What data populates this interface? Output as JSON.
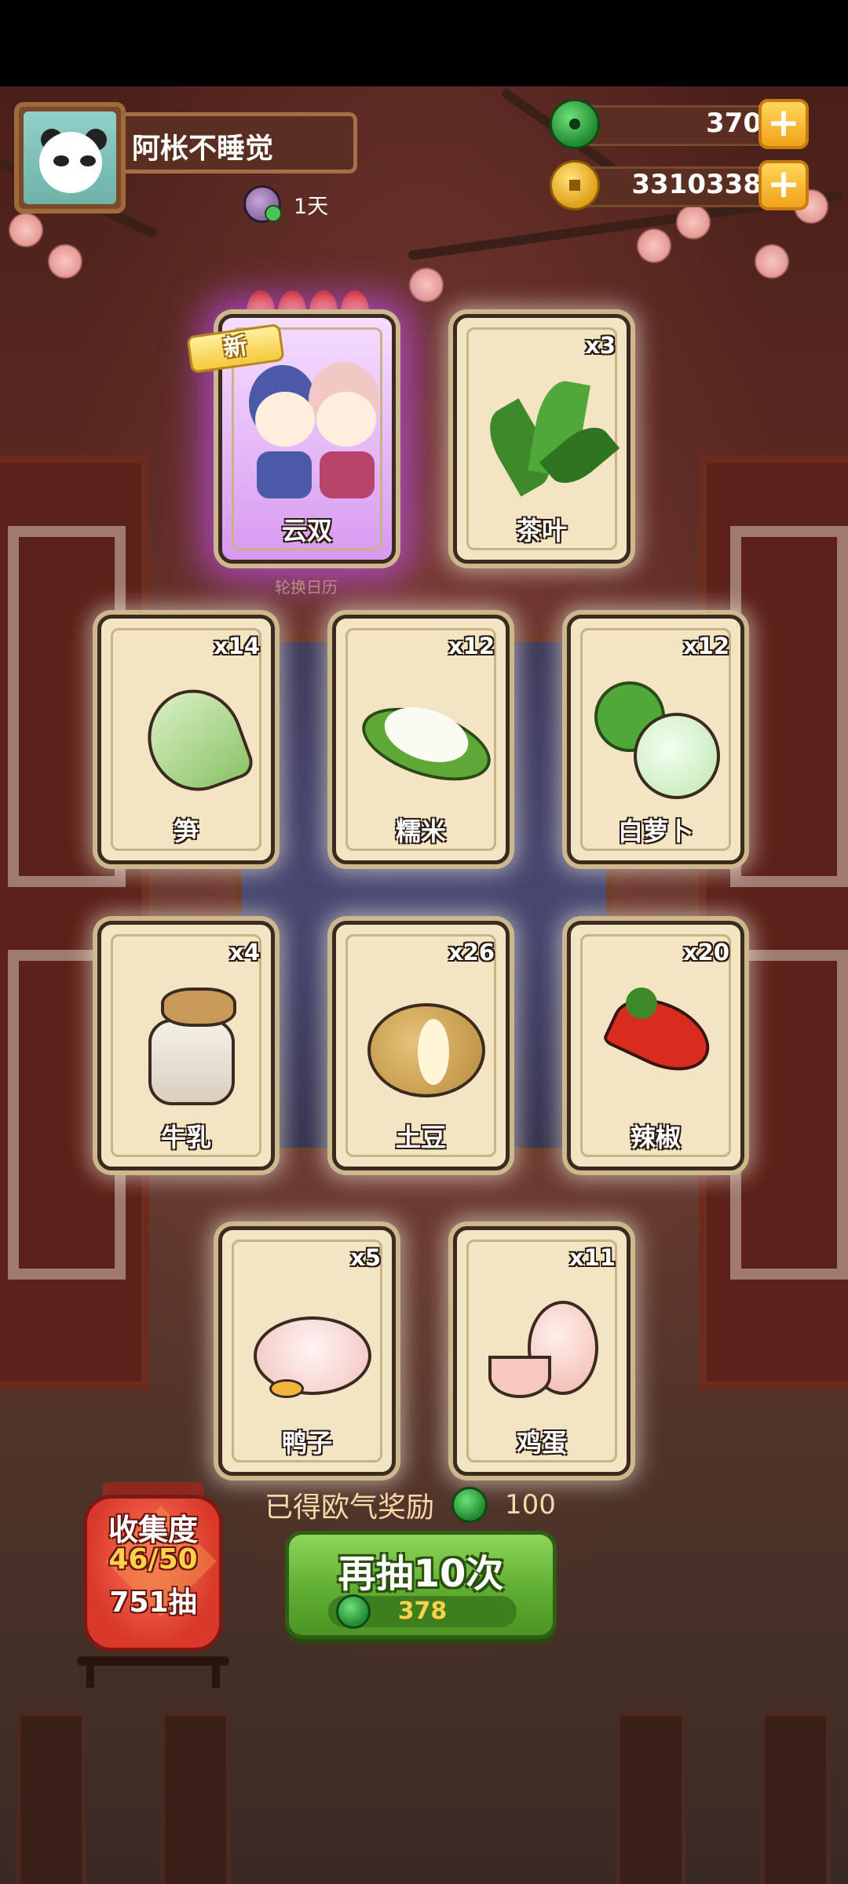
{
  "player": {
    "name": "阿枨不睡觉",
    "days": "1天"
  },
  "currency": {
    "jade": "370",
    "gold": "3310338"
  },
  "cards": [
    {
      "name": "云双",
      "qty": "",
      "badge": "新",
      "rarity": "special",
      "stars": 4
    },
    {
      "name": "茶叶",
      "qty": "x3"
    },
    {
      "name": "笋",
      "qty": "x14"
    },
    {
      "name": "糯米",
      "qty": "x12"
    },
    {
      "name": "白萝卜",
      "qty": "x12"
    },
    {
      "name": "牛乳",
      "qty": "x4"
    },
    {
      "name": "土豆",
      "qty": "x26"
    },
    {
      "name": "辣椒",
      "qty": "x20"
    },
    {
      "name": "鸭子",
      "qty": "x5"
    },
    {
      "name": "鸡蛋",
      "qty": "x11"
    }
  ],
  "background_label": "轮换日历",
  "reward": {
    "label": "已得欧气奖励",
    "value": "100"
  },
  "draw": {
    "label": "再抽10次",
    "cost": "378"
  },
  "collection": {
    "title": "收集度",
    "progress": "46/50",
    "draws": "751抽"
  },
  "icons": {
    "jade_coin": "jade-coin-icon",
    "gold_coin": "gold-coin-icon",
    "plus": "plus-icon",
    "fire": "fire-icon"
  },
  "colors": {
    "accent_green": "#5fae31",
    "gold": "#f0a21a",
    "card_bg": "#f3e4c4"
  }
}
